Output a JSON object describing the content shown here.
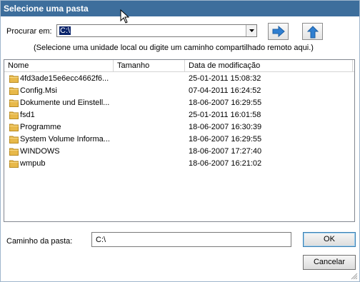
{
  "window": {
    "title": "Selecione uma pasta"
  },
  "look_in": {
    "label": "Procurar em:",
    "value": "C:\\"
  },
  "hint": "(Selecione uma unidade local ou digite um caminho compartilhado remoto aqui.)",
  "columns": {
    "name": "Nome",
    "size": "Tamanho",
    "date": "Data de modificação"
  },
  "rows": [
    {
      "name": "4fd3ade15e6ecc4662f6...",
      "size": "",
      "date": "25-01-2011 15:08:32"
    },
    {
      "name": "Config.Msi",
      "size": "",
      "date": "07-04-2011 16:24:52"
    },
    {
      "name": "Dokumente und Einstell...",
      "size": "",
      "date": "18-06-2007 16:29:55"
    },
    {
      "name": "fsd1",
      "size": "",
      "date": "25-01-2011 16:01:58"
    },
    {
      "name": "Programme",
      "size": "",
      "date": "18-06-2007 16:30:39"
    },
    {
      "name": "System Volume Informa...",
      "size": "",
      "date": "18-06-2007 16:29:55"
    },
    {
      "name": "WINDOWS",
      "size": "",
      "date": "18-06-2007 17:27:40"
    },
    {
      "name": "wmpub",
      "size": "",
      "date": "18-06-2007 16:21:02"
    }
  ],
  "path": {
    "label": "Caminho da pasta:",
    "value": "C:\\"
  },
  "buttons": {
    "ok": "OK",
    "cancel": "Cancelar"
  },
  "icons": {
    "row_icon": "folder-icon",
    "forward": "arrow-right-icon",
    "up": "folder-up-icon"
  },
  "colors": {
    "title_bar": "#3d6e9c",
    "folder": "#e8b94a",
    "arrow": "#2f7fd1",
    "selection": "#0a246a"
  }
}
